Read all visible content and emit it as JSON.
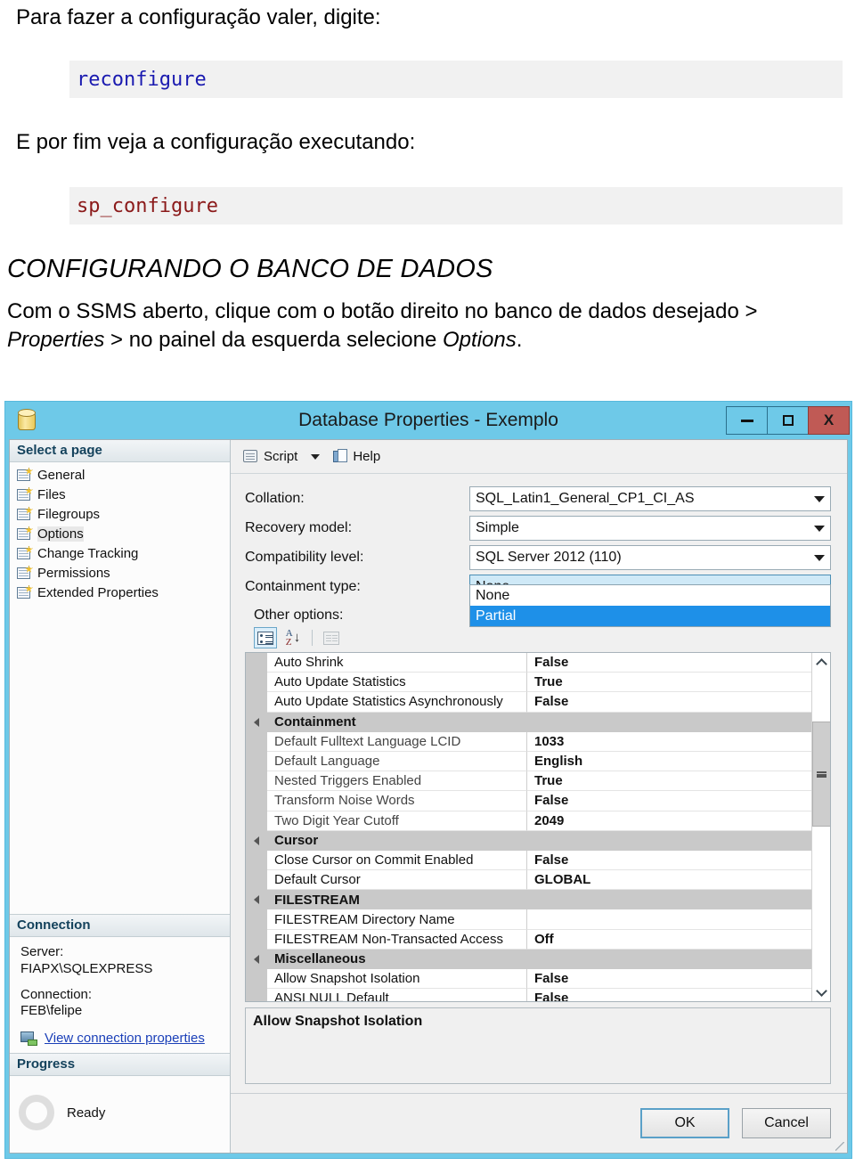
{
  "doc": {
    "line1": "Para fazer a configuração valer, digite:",
    "code1": "reconfigure",
    "line2": "E por fim veja a configuração executando:",
    "code2": "sp_configure",
    "heading": "CONFIGURANDO O BANCO DE DADOS",
    "body_part1": "Com o SSMS aberto, clique com o botão direito no banco de dados desejado > ",
    "body_em1": "Properties",
    "body_part2": " > no painel da esquerda selecione ",
    "body_em2": "Options",
    "body_part3": "."
  },
  "dialog": {
    "title": "Database Properties - Exemplo",
    "icon": "database-icon",
    "window_buttons": {
      "minimize": "–",
      "maximize": "□",
      "close": "X"
    },
    "toolbar": {
      "script_label": "Script",
      "help_label": "Help",
      "script_icon": "script-icon",
      "dropdown_icon": "chevron-down-icon",
      "help_icon": "help-icon"
    },
    "select_page": {
      "header": "Select a page",
      "items": [
        {
          "label": "General",
          "selected": false
        },
        {
          "label": "Files",
          "selected": false
        },
        {
          "label": "Filegroups",
          "selected": false
        },
        {
          "label": "Options",
          "selected": true
        },
        {
          "label": "Change Tracking",
          "selected": false
        },
        {
          "label": "Permissions",
          "selected": false
        },
        {
          "label": "Extended Properties",
          "selected": false
        }
      ]
    },
    "connection": {
      "header": "Connection",
      "server_label": "Server:",
      "server_value": "FIAPX\\SQLEXPRESS",
      "connection_label": "Connection:",
      "connection_value": "FEB\\felipe",
      "link": "View connection properties",
      "link_icon": "network-connection-icon"
    },
    "progress": {
      "header": "Progress",
      "status": "Ready",
      "spinner_icon": "spinner-icon"
    },
    "fields": [
      {
        "label": "Collation:",
        "value": "SQL_Latin1_General_CP1_CI_AS",
        "focused": false
      },
      {
        "label": "Recovery model:",
        "value": "Simple",
        "focused": false
      },
      {
        "label": "Compatibility level:",
        "value": "SQL Server 2012 (110)",
        "focused": false
      },
      {
        "label": "Containment type:",
        "value": "None",
        "focused": true
      }
    ],
    "containment_dropdown": {
      "open": true,
      "options": [
        {
          "label": "None",
          "selected": false
        },
        {
          "label": "Partial",
          "selected": true
        }
      ]
    },
    "other_options_label": "Other options:",
    "grid_toolbar": {
      "categorized": "categorized-view-button",
      "alphabetical": "alphabetical-sort-button",
      "property_pages": "property-pages-button"
    },
    "grid_rows": [
      {
        "type": "prop",
        "name": "Auto Shrink",
        "value": "False",
        "enabled": true
      },
      {
        "type": "prop",
        "name": "Auto Update Statistics",
        "value": "True",
        "enabled": true
      },
      {
        "type": "prop",
        "name": "Auto Update Statistics Asynchronously",
        "value": "False",
        "enabled": true
      },
      {
        "type": "category",
        "name": "Containment",
        "value": ""
      },
      {
        "type": "prop",
        "name": "Default Fulltext Language LCID",
        "value": "1033",
        "enabled": false
      },
      {
        "type": "prop",
        "name": "Default Language",
        "value": "English",
        "enabled": false
      },
      {
        "type": "prop",
        "name": "Nested Triggers Enabled",
        "value": "True",
        "enabled": false
      },
      {
        "type": "prop",
        "name": "Transform Noise Words",
        "value": "False",
        "enabled": false
      },
      {
        "type": "prop",
        "name": "Two Digit Year Cutoff",
        "value": "2049",
        "enabled": false
      },
      {
        "type": "category",
        "name": "Cursor",
        "value": ""
      },
      {
        "type": "prop",
        "name": "Close Cursor on Commit Enabled",
        "value": "False",
        "enabled": true
      },
      {
        "type": "prop",
        "name": "Default Cursor",
        "value": "GLOBAL",
        "enabled": true
      },
      {
        "type": "category",
        "name": "FILESTREAM",
        "value": ""
      },
      {
        "type": "prop",
        "name": "FILESTREAM Directory Name",
        "value": "",
        "enabled": true
      },
      {
        "type": "prop",
        "name": "FILESTREAM Non-Transacted Access",
        "value": "Off",
        "enabled": true
      },
      {
        "type": "category",
        "name": "Miscellaneous",
        "value": ""
      },
      {
        "type": "prop",
        "name": "Allow Snapshot Isolation",
        "value": "False",
        "enabled": true
      },
      {
        "type": "prop",
        "name": "ANSI NULL Default",
        "value": "False",
        "enabled": true
      }
    ],
    "description": "Allow Snapshot Isolation",
    "buttons": {
      "ok": "OK",
      "cancel": "Cancel"
    }
  },
  "colors": {
    "titlebar": "#6ec9e8",
    "close_button": "#c05a55",
    "selection_blue": "#1e90e8",
    "focus_field": "#cfe9f7",
    "code_blue": "#1a1ab0",
    "code_red": "#8b1a1a",
    "code_bg": "#f1f1f1"
  }
}
